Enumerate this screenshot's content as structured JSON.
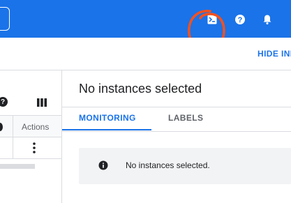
{
  "topbar": {
    "icons": [
      "terminal-icon",
      "help-icon",
      "bell-icon"
    ],
    "accent_color": "#1a73e8"
  },
  "subheader": {
    "hide_info_label": "HIDE INF"
  },
  "left_pane": {
    "actions_header": "Actions"
  },
  "details": {
    "title": "No instances selected",
    "tabs": [
      {
        "label": "MONITORING",
        "active": true
      },
      {
        "label": "LABELS",
        "active": false
      }
    ],
    "notice_text": "No instances selected."
  },
  "annotation_color": "#f4511e"
}
